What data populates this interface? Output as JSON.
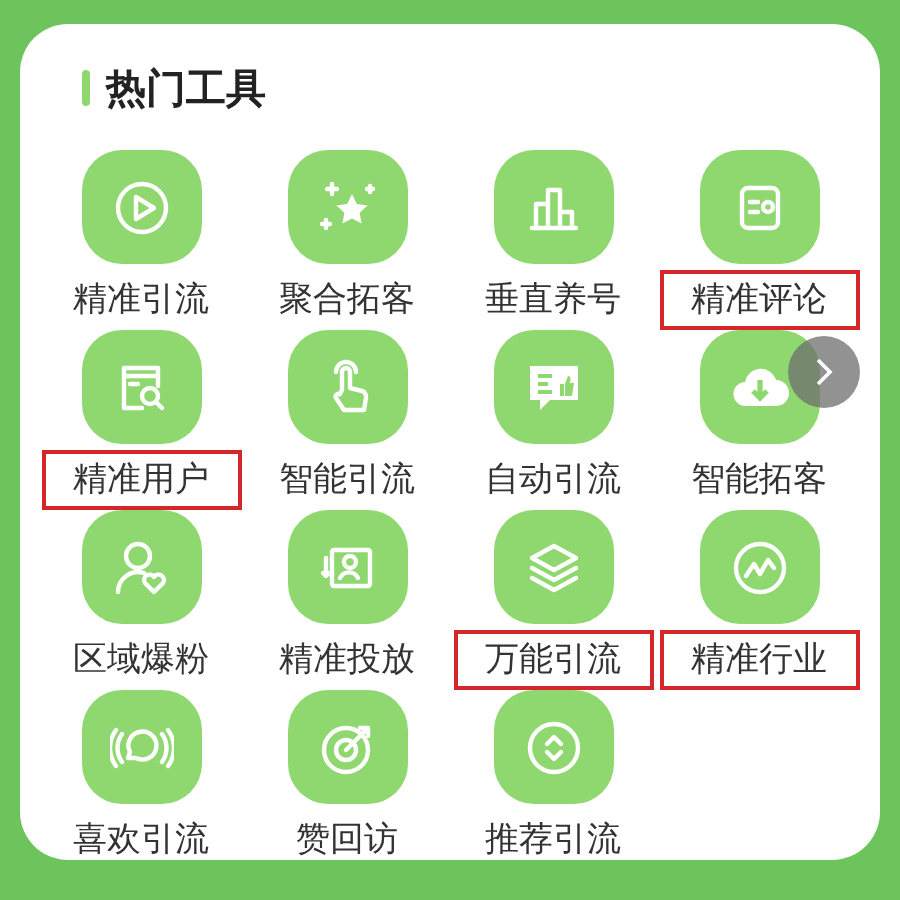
{
  "section": {
    "title": "热门工具"
  },
  "tools": [
    {
      "label": "精准引流",
      "highlighted": false
    },
    {
      "label": "聚合拓客",
      "highlighted": false
    },
    {
      "label": "垂直养号",
      "highlighted": false
    },
    {
      "label": "精准评论",
      "highlighted": true
    },
    {
      "label": "精准用户",
      "highlighted": true
    },
    {
      "label": "智能引流",
      "highlighted": false
    },
    {
      "label": "自动引流",
      "highlighted": false
    },
    {
      "label": "智能拓客",
      "highlighted": false
    },
    {
      "label": "区域爆粉",
      "highlighted": false
    },
    {
      "label": "精准投放",
      "highlighted": false
    },
    {
      "label": "万能引流",
      "highlighted": true
    },
    {
      "label": "精准行业",
      "highlighted": true
    },
    {
      "label": "喜欢引流",
      "highlighted": false
    },
    {
      "label": "赞回访",
      "highlighted": false
    },
    {
      "label": "推荐引流",
      "highlighted": false
    }
  ]
}
